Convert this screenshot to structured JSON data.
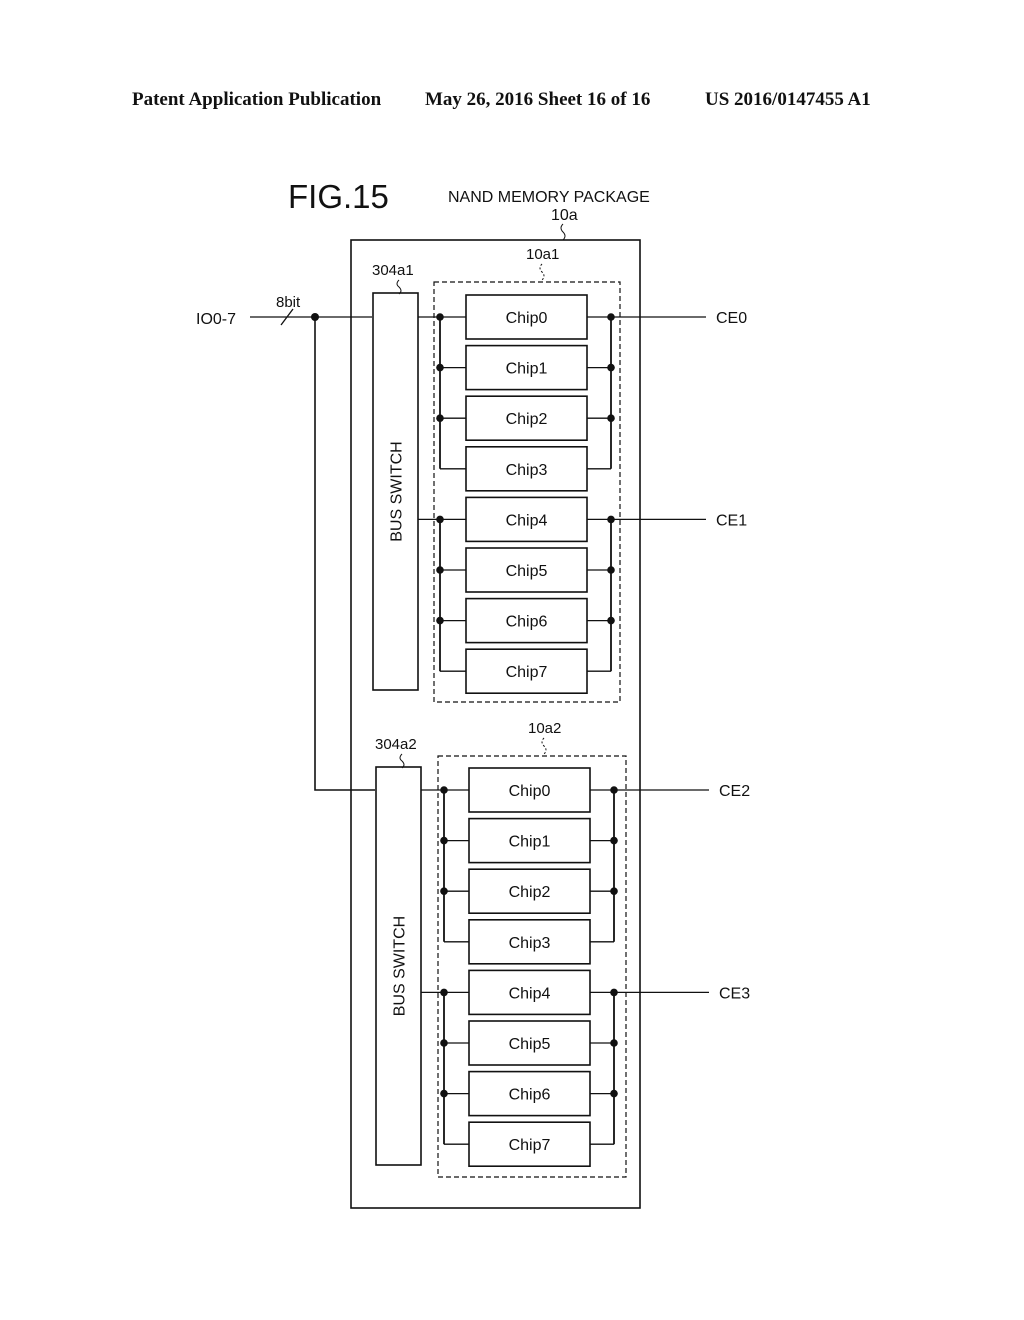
{
  "header": {
    "publication": "Patent Application Publication",
    "date_sheet": "May 26, 2016  Sheet 16 of 16",
    "number": "US 2016/0147455 A1"
  },
  "figure": {
    "title": "FIG.15",
    "package_label": "NAND MEMORY PACKAGE",
    "package_ref": "10a",
    "input_label": "IO0-7",
    "bus_width": "8bit",
    "groups": [
      {
        "ref": "10a1",
        "switch_ref": "304a1",
        "switch_label": "BUS SWITCH",
        "chips": [
          "Chip0",
          "Chip1",
          "Chip2",
          "Chip3",
          "Chip4",
          "Chip5",
          "Chip6",
          "Chip7"
        ],
        "ce_labels": [
          "CE0",
          "CE1"
        ]
      },
      {
        "ref": "10a2",
        "switch_ref": "304a2",
        "switch_label": "BUS SWITCH",
        "chips": [
          "Chip0",
          "Chip1",
          "Chip2",
          "Chip3",
          "Chip4",
          "Chip5",
          "Chip6",
          "Chip7"
        ],
        "ce_labels": [
          "CE2",
          "CE3"
        ]
      }
    ]
  }
}
